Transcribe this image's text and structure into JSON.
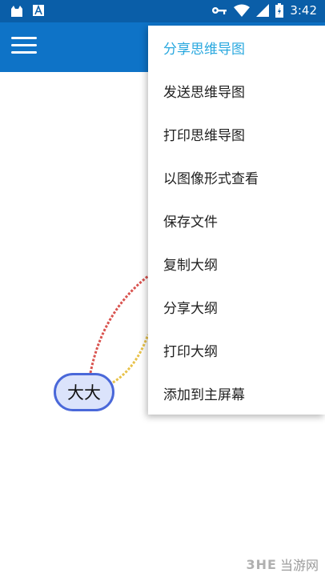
{
  "status_bar": {
    "time": "3:42",
    "icons": [
      "cat-app-icon",
      "font-app-icon",
      "key-icon",
      "wifi-icon",
      "signal-icon",
      "battery-icon"
    ]
  },
  "app_bar": {
    "menu_icon": "hamburger-menu-icon"
  },
  "mind_map": {
    "central_node": "大大"
  },
  "overflow_menu": {
    "items": [
      {
        "label": "分享思维导图"
      },
      {
        "label": "发送思维导图"
      },
      {
        "label": "打印思维导图"
      },
      {
        "label": "以图像形式查看"
      },
      {
        "label": "保存文件"
      },
      {
        "label": "复制大纲"
      },
      {
        "label": "分享大纲"
      },
      {
        "label": "打印大纲"
      },
      {
        "label": "添加到主屏幕"
      }
    ]
  },
  "watermark": {
    "logo": "3HE",
    "text": "当游网"
  },
  "colors": {
    "status_bar": "#0a5ea8",
    "app_bar": "#0e73c7",
    "menu_highlight": "#29a8df",
    "node_border": "#4a68d9",
    "node_fill": "#dbe3fb",
    "branch_red": "#d9534f",
    "branch_yellow": "#e8c24a"
  }
}
